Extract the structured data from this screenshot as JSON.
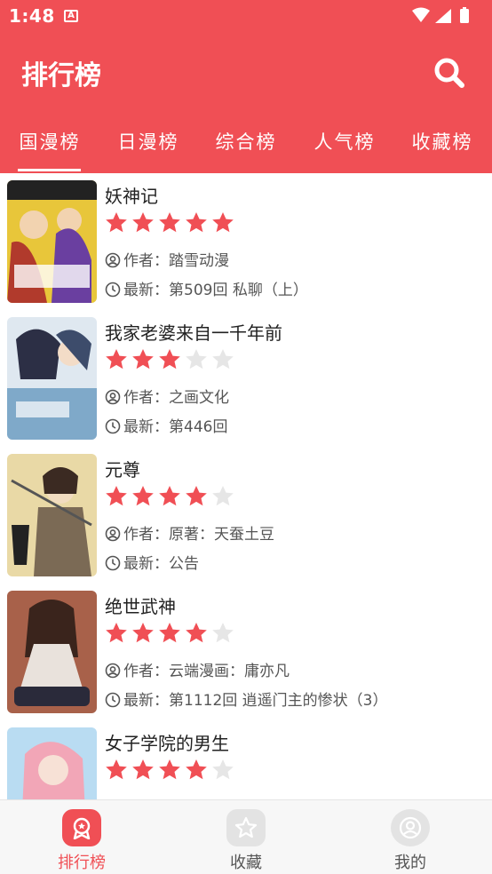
{
  "status": {
    "time": "1:48",
    "notif_icon": "A"
  },
  "appbar": {
    "title": "排行榜"
  },
  "tabs": [
    {
      "label": "国漫榜",
      "active": true
    },
    {
      "label": "日漫榜",
      "active": false
    },
    {
      "label": "综合榜",
      "active": false
    },
    {
      "label": "人气榜",
      "active": false
    },
    {
      "label": "收藏榜",
      "active": false
    }
  ],
  "comics": [
    {
      "title": "妖神记",
      "rating": 5,
      "author": "作者：踏雪动漫",
      "latest": "最新：第509回 私聊（上）"
    },
    {
      "title": "我家老婆来自一千年前",
      "rating": 3,
      "author": "作者：之画文化",
      "latest": "最新：第446回"
    },
    {
      "title": "元尊",
      "rating": 4,
      "author": "作者：原著：天蚕土豆",
      "latest": "最新：公告"
    },
    {
      "title": "绝世武神",
      "rating": 4,
      "author": "作者：云端漫画：庸亦凡",
      "latest": "最新：第1112回 逍遥门主的惨状（3）"
    },
    {
      "title": "女子学院的男生",
      "rating": 4,
      "author": "",
      "latest": ""
    }
  ],
  "bottom_nav": [
    {
      "label": "排行榜",
      "icon": "ranking-icon",
      "active": true
    },
    {
      "label": "收藏",
      "icon": "star-icon",
      "active": false
    },
    {
      "label": "我的",
      "icon": "user-icon",
      "active": false
    }
  ],
  "colors": {
    "primary": "#f04f55",
    "star_on": "#f04f55",
    "star_off": "#e6e6e6",
    "nav_inactive": "#555555"
  }
}
